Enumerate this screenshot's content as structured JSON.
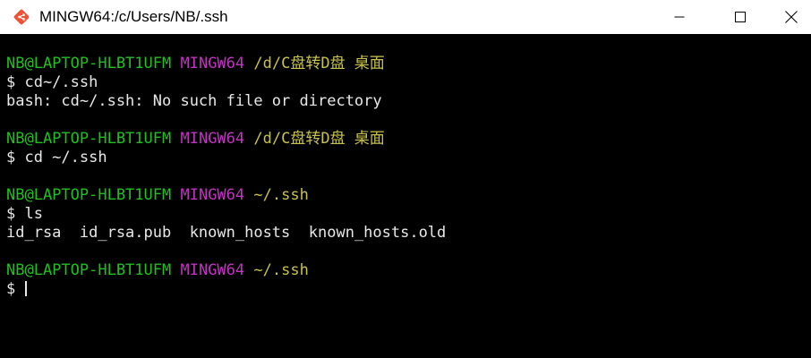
{
  "window": {
    "title": "MINGW64:/c/Users/NB/.ssh",
    "icon": "git-bash-icon",
    "controls": [
      "minimize-icon",
      "maximize-icon",
      "close-icon"
    ]
  },
  "colors": {
    "terminal_bg": "#000000",
    "user_host": "#1ec21e",
    "shell": "#c233c2",
    "path": "#c8c24a",
    "text": "#e8e8e8",
    "git_icon": "#f05033"
  },
  "terminal": {
    "blocks": [
      {
        "prompt": {
          "user_host": "NB@LAPTOP-HLBT1UFM",
          "shell": "MINGW64",
          "path": "/d/C盘转D盘 桌面"
        },
        "command": "$ cd~/.ssh",
        "output": [
          "bash: cd~/.ssh: No such file or directory"
        ]
      },
      {
        "prompt": {
          "user_host": "NB@LAPTOP-HLBT1UFM",
          "shell": "MINGW64",
          "path": "/d/C盘转D盘 桌面"
        },
        "command": "$ cd ~/.ssh",
        "output": []
      },
      {
        "prompt": {
          "user_host": "NB@LAPTOP-HLBT1UFM",
          "shell": "MINGW64",
          "path": "~/.ssh"
        },
        "command": "$ ls",
        "output": [
          "id_rsa  id_rsa.pub  known_hosts  known_hosts.old"
        ]
      },
      {
        "prompt": {
          "user_host": "NB@LAPTOP-HLBT1UFM",
          "shell": "MINGW64",
          "path": "~/.ssh"
        },
        "command": "$ ",
        "output": []
      }
    ]
  }
}
